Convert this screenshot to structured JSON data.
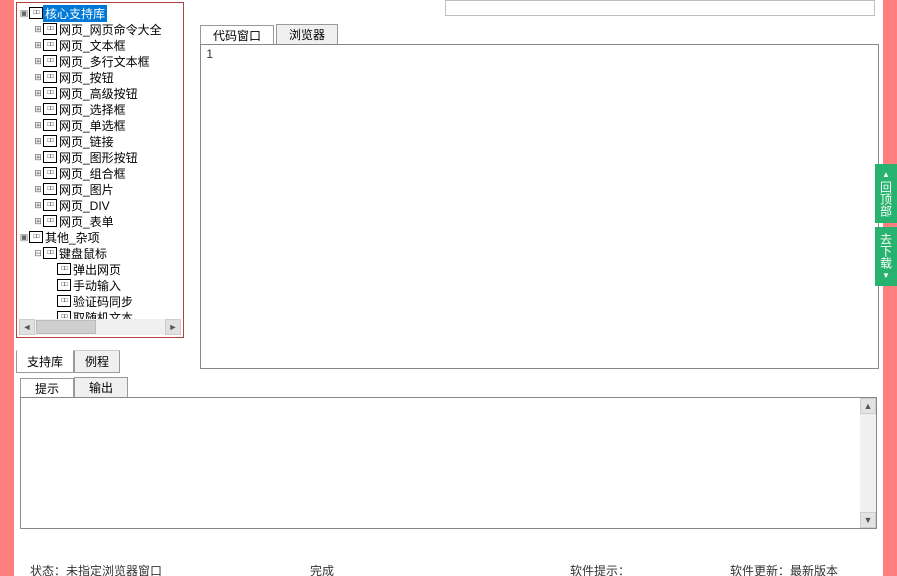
{
  "tree": {
    "root1": {
      "label": "核心支持库",
      "selected": true
    },
    "items": [
      {
        "label": "网页_网页命令大全"
      },
      {
        "label": "网页_文本框"
      },
      {
        "label": "网页_多行文本框"
      },
      {
        "label": "网页_按钮"
      },
      {
        "label": "网页_高级按钮"
      },
      {
        "label": "网页_选择框"
      },
      {
        "label": "网页_单选框"
      },
      {
        "label": "网页_链接"
      },
      {
        "label": "网页_图形按钮"
      },
      {
        "label": "网页_组合框"
      },
      {
        "label": "网页_图片"
      },
      {
        "label": "网页_DIV"
      },
      {
        "label": "网页_表单"
      }
    ],
    "root2": {
      "label": "其他_杂项"
    },
    "sub2": [
      {
        "label": "键盘鼠标"
      },
      {
        "label": "弹出网页"
      },
      {
        "label": "手动输入"
      },
      {
        "label": "验证码同步"
      },
      {
        "label": "取随机文本"
      }
    ]
  },
  "left_tabs": {
    "active": "支持库",
    "other": "例程"
  },
  "code_tabs": {
    "active": "代码窗口",
    "other": "浏览器"
  },
  "code_gutter": "1",
  "bottom_tabs": {
    "active": "提示",
    "other": "输出"
  },
  "status": {
    "s1": "状态：未指定浏览器窗口",
    "s2": "完成",
    "s3": "软件提示：",
    "s4": "软件更新：最新版本"
  },
  "float": {
    "top": "回顶部",
    "down": "去下载"
  }
}
